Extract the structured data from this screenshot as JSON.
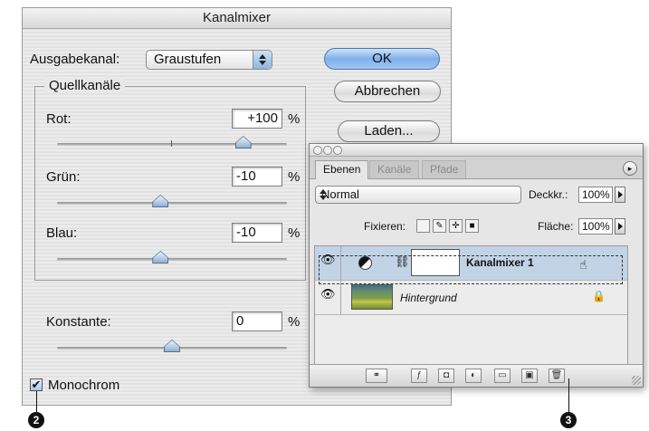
{
  "dialog": {
    "title": "Kanalmixer",
    "output_channel_label": "Ausgabekanal:",
    "output_channel_value": "Graustufen",
    "buttons": {
      "ok": "OK",
      "cancel": "Abbrechen",
      "load": "Laden..."
    },
    "source_group_label": "Quellkanäle",
    "channels": [
      {
        "label": "Rot:",
        "value": "+100",
        "unit": "%",
        "slider_pct": 0.81
      },
      {
        "label": "Grün:",
        "value": "-10",
        "unit": "%",
        "slider_pct": 0.45
      },
      {
        "label": "Blau:",
        "value": "-10",
        "unit": "%",
        "slider_pct": 0.45
      }
    ],
    "constant": {
      "label": "Konstante:",
      "value": "0",
      "unit": "%",
      "slider_pct": 0.5
    },
    "monochrome": {
      "label": "Monochrom",
      "checked": true,
      "mark": "✔"
    }
  },
  "callouts": {
    "left": "2",
    "right": "3"
  },
  "layers_palette": {
    "tabs": [
      "Ebenen",
      "Kanäle",
      "Pfade"
    ],
    "blend_mode": "Normal",
    "opacity_label": "Deckkr.:",
    "opacity_value": "100%",
    "lock_label": "Fixieren:",
    "fill_label": "Fläche:",
    "fill_value": "100%",
    "layers": [
      {
        "name": "Kanalmixer 1",
        "selected": true
      },
      {
        "name": "Hintergrund",
        "selected": false
      }
    ],
    "icons": {
      "eye": "👁",
      "lock": "🔒",
      "menu": "▸"
    }
  },
  "colors": {
    "accent": "#7fb0ea",
    "selection": "#c3d3e6"
  }
}
